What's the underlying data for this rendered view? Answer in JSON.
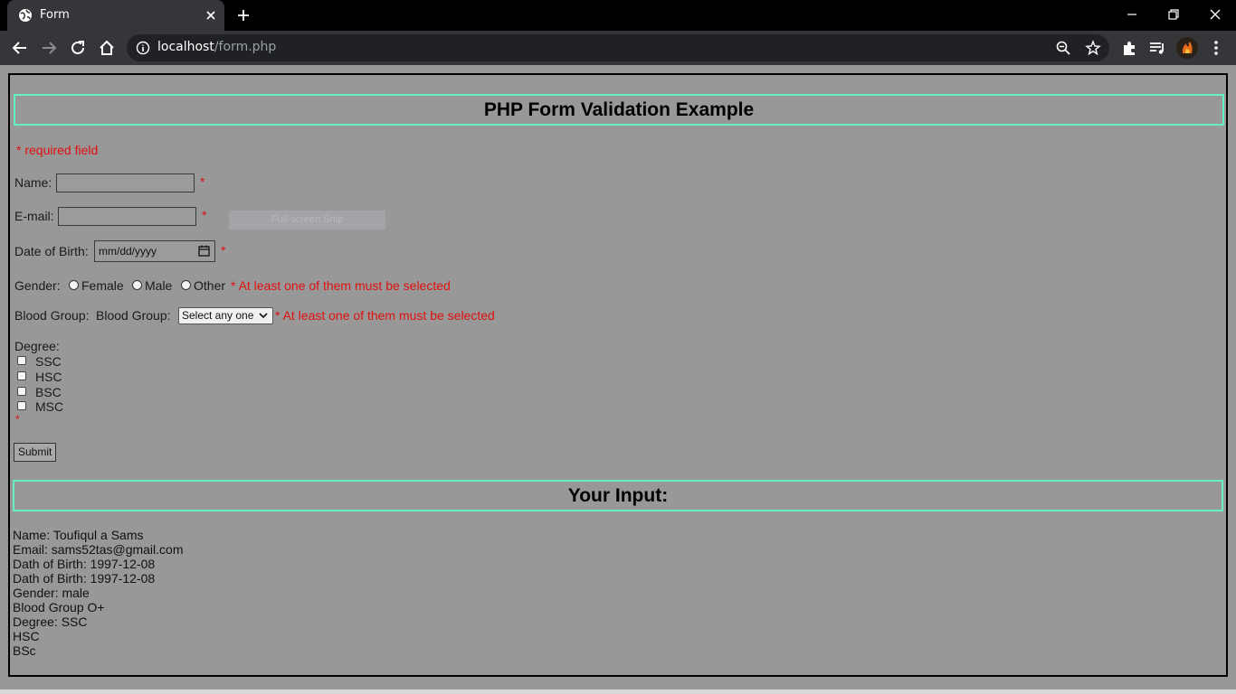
{
  "browser": {
    "tab_title": "Form",
    "url_host": "localhost",
    "url_path": "/form.php"
  },
  "form": {
    "heading": "PHP Form Validation Example",
    "required_note": "* required field",
    "name_label": "Name:",
    "name_value": "",
    "email_label": "E-mail:",
    "email_value": "",
    "dob_label": "Date of Birth:",
    "dob_placeholder": "mm/dd/yyyy",
    "asterisk": "*",
    "gender_label": "Gender:",
    "gender_options": [
      "Female",
      "Male",
      "Other"
    ],
    "gender_error": "* At least one of them must be selected",
    "blood_label": "Blood Group:",
    "blood_inner_label": "Blood Group:",
    "blood_select_value": "Select any one",
    "blood_error": "* At least one of them must be selected",
    "degree_label": "Degree:",
    "degree_options": [
      "SSC",
      "HSC",
      "BSC",
      "MSC"
    ],
    "submit_label": "Submit"
  },
  "overlay": {
    "snip_label": "Full-screen Snip"
  },
  "output": {
    "heading": "Your Input:",
    "lines": [
      "Name: Toufiqul a Sams",
      "Email: sams52tas@gmail.com",
      "Dath of Birth: 1997-12-08",
      "Dath of Birth: 1997-12-08",
      "Gender: male",
      "Blood Group O+",
      "Degree: SSC",
      "HSC",
      "BSc"
    ]
  },
  "colors": {
    "page_bg": "#989898",
    "heading_border": "#66f0c4",
    "required": "#e01010"
  }
}
